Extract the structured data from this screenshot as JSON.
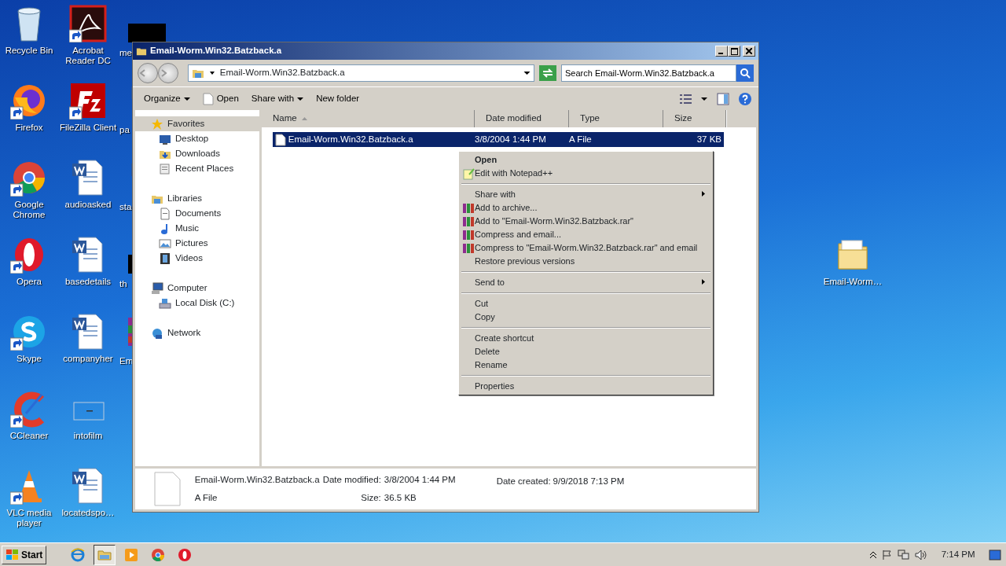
{
  "desktop": {
    "columns": [
      [
        {
          "label": "Recycle Bin",
          "kind": "recycle",
          "shortcut": false
        },
        {
          "label": "Firefox",
          "kind": "firefox",
          "shortcut": true
        },
        {
          "label": "Google Chrome",
          "kind": "chrome",
          "shortcut": true
        },
        {
          "label": "Opera",
          "kind": "opera",
          "shortcut": true
        },
        {
          "label": "Skype",
          "kind": "skype",
          "shortcut": true
        },
        {
          "label": "CCleaner",
          "kind": "ccleaner",
          "shortcut": true
        },
        {
          "label": "VLC media player",
          "kind": "vlc",
          "shortcut": true
        }
      ],
      [
        {
          "label": "Acrobat Reader DC",
          "kind": "acrobat",
          "shortcut": true
        },
        {
          "label": "FileZilla Client",
          "kind": "filezilla",
          "shortcut": true
        },
        {
          "label": "audioasked",
          "kind": "word",
          "shortcut": false
        },
        {
          "label": "basedetails",
          "kind": "word",
          "shortcut": false
        },
        {
          "label": "companyher",
          "kind": "word",
          "shortcut": false
        },
        {
          "label": "intofilm",
          "kind": "blank",
          "shortcut": false
        },
        {
          "label": "locatedspo…",
          "kind": "word",
          "shortcut": false
        }
      ],
      [
        {
          "label": "me",
          "kind": "dark"
        },
        {
          "label": "pa",
          "kind": "word"
        },
        {
          "label": "sta",
          "kind": "word"
        },
        {
          "label": "th",
          "kind": "dark"
        },
        {
          "label": "Em",
          "kind": "archive"
        }
      ]
    ],
    "right_icon": {
      "label": "Email-Worm…",
      "kind": "folder"
    }
  },
  "window": {
    "title": "Email-Worm.Win32.Batzback.a",
    "address": {
      "path": "Email-Worm.Win32.Batzback.a"
    },
    "search": {
      "placeholder": "Search Email-Worm.Win32.Batzback.a"
    },
    "toolbar": [
      {
        "label": "Organize",
        "kind": "dropdown"
      },
      {
        "label": "Open",
        "kind": "icon"
      },
      {
        "label": "Share with",
        "kind": "dropdown"
      },
      {
        "label": "New folder",
        "kind": "plain"
      }
    ],
    "nav": [
      {
        "label": "Favorites",
        "kind": "star",
        "selected": true,
        "children": [
          {
            "label": "Desktop",
            "kind": "monitor"
          },
          {
            "label": "Downloads",
            "kind": "download"
          },
          {
            "label": "Recent Places",
            "kind": "recent"
          }
        ]
      },
      {
        "label": "Libraries",
        "kind": "library",
        "selected": false,
        "children": [
          {
            "label": "Documents",
            "kind": "doc"
          },
          {
            "label": "Music",
            "kind": "music"
          },
          {
            "label": "Pictures",
            "kind": "pictures"
          },
          {
            "label": "Videos",
            "kind": "video"
          }
        ]
      },
      {
        "label": "Computer",
        "kind": "computer",
        "selected": false,
        "children": [
          {
            "label": "Local Disk (C:)",
            "kind": "disk"
          }
        ]
      },
      {
        "label": "Network",
        "kind": "network",
        "selected": false
      }
    ],
    "columns": [
      {
        "label": "Name",
        "sorted": true
      },
      {
        "label": "Date modified",
        "sorted": false
      },
      {
        "label": "Type",
        "sorted": false
      },
      {
        "label": "Size",
        "sorted": false
      }
    ],
    "rows": [
      {
        "name": "Email-Worm.Win32.Batzback.a",
        "date": "3/8/2004 1:44 PM",
        "type": "A File",
        "size": "37 KB",
        "selected": true
      }
    ],
    "details": {
      "name": "Email-Worm.Win32.Batzback.a",
      "type": "A File",
      "fields": [
        {
          "label": "Date modified:",
          "value": "3/8/2004 1:44 PM"
        },
        {
          "label": "Size:",
          "value": "36.5 KB"
        },
        {
          "label": "Date created:",
          "value": "9/9/2018 7:13 PM"
        }
      ]
    }
  },
  "context_menu": [
    {
      "kind": "plain",
      "label": "Open",
      "bold": true,
      "submenu": false
    },
    {
      "kind": "notepad",
      "label": "Edit with Notepad++",
      "bold": false,
      "submenu": false
    },
    {
      "kind": "separator"
    },
    {
      "kind": "plain",
      "label": "Share with",
      "bold": false,
      "submenu": true
    },
    {
      "kind": "archive",
      "label": "Add to archive...",
      "bold": false,
      "submenu": false
    },
    {
      "kind": "archive",
      "label": "Add to \"Email-Worm.Win32.Batzback.rar\"",
      "bold": false,
      "submenu": false
    },
    {
      "kind": "archive",
      "label": "Compress and email...",
      "bold": false,
      "submenu": false
    },
    {
      "kind": "archive",
      "label": "Compress to \"Email-Worm.Win32.Batzback.rar\" and email",
      "bold": false,
      "submenu": false
    },
    {
      "kind": "plain",
      "label": "Restore previous versions",
      "bold": false,
      "submenu": false
    },
    {
      "kind": "separator"
    },
    {
      "kind": "plain",
      "label": "Send to",
      "bold": false,
      "submenu": true
    },
    {
      "kind": "separator"
    },
    {
      "kind": "plain",
      "label": "Cut",
      "bold": false,
      "submenu": false
    },
    {
      "kind": "plain",
      "label": "Copy",
      "bold": false,
      "submenu": false
    },
    {
      "kind": "separator"
    },
    {
      "kind": "plain",
      "label": "Create shortcut",
      "bold": false,
      "submenu": false
    },
    {
      "kind": "plain",
      "label": "Delete",
      "bold": false,
      "submenu": false
    },
    {
      "kind": "plain",
      "label": "Rename",
      "bold": false,
      "submenu": false
    },
    {
      "kind": "separator"
    },
    {
      "kind": "plain",
      "label": "Properties",
      "bold": false,
      "submenu": false
    }
  ],
  "taskbar": {
    "start": "Start",
    "apps": [
      {
        "kind": "ie",
        "active": false
      },
      {
        "kind": "explorer",
        "active": true
      },
      {
        "kind": "media",
        "active": false
      },
      {
        "kind": "chrome",
        "active": false
      },
      {
        "kind": "opera",
        "active": false
      }
    ],
    "clock": "7:14 PM"
  }
}
